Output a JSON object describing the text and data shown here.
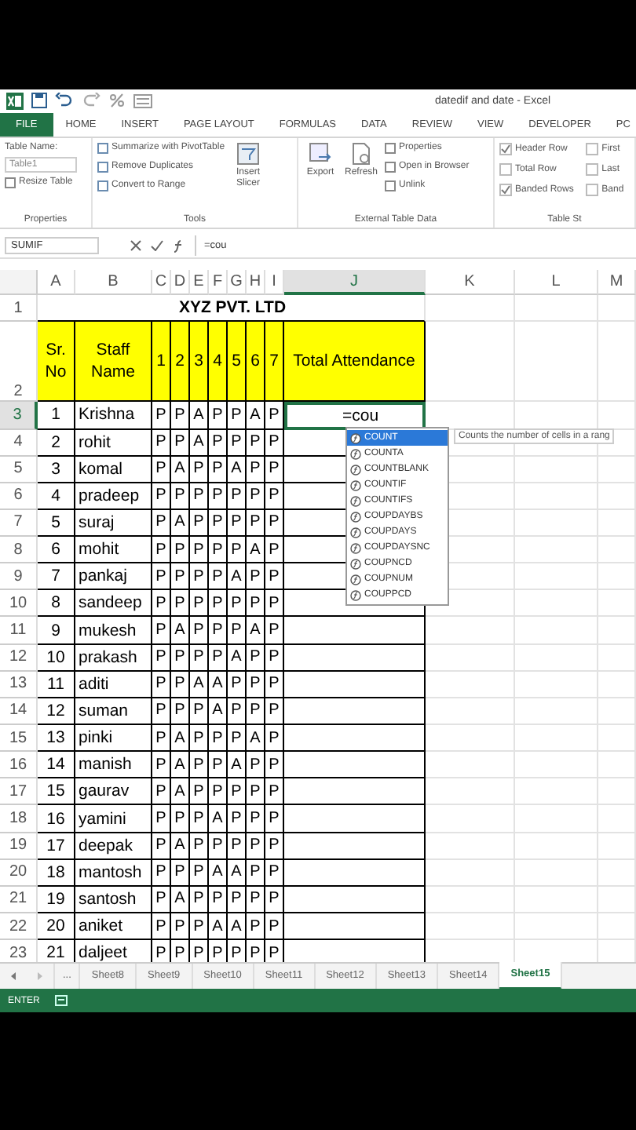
{
  "title_bar": {
    "title": "datedif and date - Excel"
  },
  "menu_tabs": [
    {
      "label": "FILE",
      "kind": "file",
      "selected": false
    },
    {
      "label": "HOME",
      "kind": "tab",
      "selected": false
    },
    {
      "label": "INSERT",
      "kind": "tab",
      "selected": false
    },
    {
      "label": "PAGE LAYOUT",
      "kind": "tab",
      "selected": false
    },
    {
      "label": "FORMULAS",
      "kind": "tab",
      "selected": false
    },
    {
      "label": "DATA",
      "kind": "tab",
      "selected": false
    },
    {
      "label": "REVIEW",
      "kind": "tab",
      "selected": false
    },
    {
      "label": "VIEW",
      "kind": "tab",
      "selected": false
    },
    {
      "label": "DEVELOPER",
      "kind": "tab",
      "selected": false
    },
    {
      "label": "PC",
      "kind": "tab",
      "selected": false
    }
  ],
  "ribbon": {
    "properties": {
      "label": "Table Name:",
      "value": "Table1",
      "resize": "Resize Table",
      "caption": "Properties"
    },
    "tools": {
      "items": [
        "Summarize with PivotTable",
        "Remove Duplicates",
        "Convert to Range"
      ],
      "slicer": "Insert Slicer",
      "caption": "Tools"
    },
    "external": {
      "export": "Export",
      "refresh": "Refresh",
      "items": [
        "Properties",
        "Open in Browser",
        "Unlink"
      ],
      "caption": "External Table Data"
    },
    "style_options": {
      "options": [
        {
          "label": "Header Row",
          "checked": true
        },
        {
          "label": "Total Row",
          "checked": false
        },
        {
          "label": "Banded Rows",
          "checked": true
        },
        {
          "label": "First",
          "checked": false
        },
        {
          "label": "Last",
          "checked": false
        },
        {
          "label": "Band",
          "checked": false
        }
      ],
      "caption": "Table St"
    }
  },
  "formula_bar": {
    "name_box": "SUMIF",
    "formula": "=cou"
  },
  "columns": [
    {
      "label": "A",
      "selected": false
    },
    {
      "label": "B",
      "selected": false
    },
    {
      "label": "C",
      "selected": false
    },
    {
      "label": "D",
      "selected": false
    },
    {
      "label": "E",
      "selected": false
    },
    {
      "label": "F",
      "selected": false
    },
    {
      "label": "G",
      "selected": false
    },
    {
      "label": "H",
      "selected": false
    },
    {
      "label": "I",
      "selected": false
    },
    {
      "label": "J",
      "selected": true
    },
    {
      "label": "K",
      "selected": false
    },
    {
      "label": "L",
      "selected": false
    },
    {
      "label": "M",
      "selected": false
    }
  ],
  "sheet": {
    "title_row": {
      "number": "1",
      "selected": false,
      "title": "XYZ PVT. LTD"
    },
    "header_row": {
      "number": "2",
      "selected": false,
      "headers": [
        "Sr. No",
        "Staff Name",
        "1",
        "2",
        "3",
        "4",
        "5",
        "6",
        "7",
        "Total Attendance"
      ]
    },
    "rows": [
      {
        "number": "3",
        "selected": true,
        "sr": "1",
        "name": "Krishna",
        "days": [
          "P",
          "P",
          "A",
          "P",
          "P",
          "A",
          "P"
        ],
        "total": "=cou"
      },
      {
        "number": "4",
        "selected": false,
        "sr": "2",
        "name": "rohit",
        "days": [
          "P",
          "P",
          "A",
          "P",
          "P",
          "P",
          "P"
        ]
      },
      {
        "number": "5",
        "selected": false,
        "sr": "3",
        "name": "komal",
        "days": [
          "P",
          "A",
          "P",
          "P",
          "A",
          "P",
          "P"
        ]
      },
      {
        "number": "6",
        "selected": false,
        "sr": "4",
        "name": "pradeep",
        "days": [
          "P",
          "P",
          "P",
          "P",
          "P",
          "P",
          "P"
        ]
      },
      {
        "number": "7",
        "selected": false,
        "sr": "5",
        "name": "suraj",
        "days": [
          "P",
          "A",
          "P",
          "P",
          "P",
          "P",
          "P"
        ]
      },
      {
        "number": "8",
        "selected": false,
        "sr": "6",
        "name": "mohit",
        "days": [
          "P",
          "P",
          "P",
          "P",
          "P",
          "A",
          "P"
        ]
      },
      {
        "number": "9",
        "selected": false,
        "sr": "7",
        "name": "pankaj",
        "days": [
          "P",
          "P",
          "P",
          "P",
          "A",
          "P",
          "P"
        ]
      },
      {
        "number": "10",
        "selected": false,
        "sr": "8",
        "name": "sandeep",
        "days": [
          "P",
          "P",
          "P",
          "P",
          "P",
          "P",
          "P"
        ]
      },
      {
        "number": "11",
        "selected": false,
        "sr": "9",
        "name": "mukesh",
        "days": [
          "P",
          "A",
          "P",
          "P",
          "P",
          "A",
          "P"
        ]
      },
      {
        "number": "12",
        "selected": false,
        "sr": "10",
        "name": "prakash",
        "days": [
          "P",
          "P",
          "P",
          "P",
          "A",
          "P",
          "P"
        ]
      },
      {
        "number": "13",
        "selected": false,
        "sr": "11",
        "name": "aditi",
        "days": [
          "P",
          "P",
          "A",
          "A",
          "P",
          "P",
          "P"
        ]
      },
      {
        "number": "14",
        "selected": false,
        "sr": "12",
        "name": "suman",
        "days": [
          "P",
          "P",
          "P",
          "A",
          "P",
          "P",
          "P"
        ]
      },
      {
        "number": "15",
        "selected": false,
        "sr": "13",
        "name": "pinki",
        "days": [
          "P",
          "A",
          "P",
          "P",
          "P",
          "A",
          "P"
        ]
      },
      {
        "number": "16",
        "selected": false,
        "sr": "14",
        "name": "manish",
        "days": [
          "P",
          "A",
          "P",
          "P",
          "A",
          "P",
          "P"
        ]
      },
      {
        "number": "17",
        "selected": false,
        "sr": "15",
        "name": "gaurav",
        "days": [
          "P",
          "A",
          "P",
          "P",
          "P",
          "P",
          "P"
        ]
      },
      {
        "number": "18",
        "selected": false,
        "sr": "16",
        "name": "yamini",
        "days": [
          "P",
          "P",
          "P",
          "A",
          "P",
          "P",
          "P"
        ]
      },
      {
        "number": "19",
        "selected": false,
        "sr": "17",
        "name": "deepak",
        "days": [
          "P",
          "A",
          "P",
          "P",
          "P",
          "P",
          "P"
        ]
      },
      {
        "number": "20",
        "selected": false,
        "sr": "18",
        "name": "mantosh",
        "days": [
          "P",
          "P",
          "P",
          "A",
          "A",
          "P",
          "P"
        ]
      },
      {
        "number": "21",
        "selected": false,
        "sr": "19",
        "name": "santosh",
        "days": [
          "P",
          "A",
          "P",
          "P",
          "P",
          "P",
          "P"
        ]
      },
      {
        "number": "22",
        "selected": false,
        "sr": "20",
        "name": "aniket",
        "days": [
          "P",
          "P",
          "P",
          "A",
          "A",
          "P",
          "P"
        ]
      },
      {
        "number": "23",
        "selected": false,
        "sr": "21",
        "name": "daljeet",
        "days": [
          "P",
          "P",
          "P",
          "P",
          "P",
          "P",
          "P"
        ]
      }
    ]
  },
  "autocomplete": {
    "items": [
      {
        "label": "COUNT",
        "selected": true
      },
      {
        "label": "COUNTA",
        "selected": false
      },
      {
        "label": "COUNTBLANK",
        "selected": false
      },
      {
        "label": "COUNTIF",
        "selected": false
      },
      {
        "label": "COUNTIFS",
        "selected": false
      },
      {
        "label": "COUPDAYBS",
        "selected": false
      },
      {
        "label": "COUPDAYS",
        "selected": false
      },
      {
        "label": "COUPDAYSNC",
        "selected": false
      },
      {
        "label": "COUPNCD",
        "selected": false
      },
      {
        "label": "COUPNUM",
        "selected": false
      },
      {
        "label": "COUPPCD",
        "selected": false
      }
    ],
    "tooltip": "Counts the number of cells in a rang"
  },
  "sheet_tabs": {
    "more": "...",
    "tabs": [
      {
        "label": "Sheet8",
        "selected": false
      },
      {
        "label": "Sheet9",
        "selected": false
      },
      {
        "label": "Sheet10",
        "selected": false
      },
      {
        "label": "Sheet11",
        "selected": false
      },
      {
        "label": "Sheet12",
        "selected": false
      },
      {
        "label": "Sheet13",
        "selected": false
      },
      {
        "label": "Sheet14",
        "selected": false
      },
      {
        "label": "Sheet15",
        "selected": true
      }
    ]
  },
  "status_bar": {
    "mode": "ENTER"
  }
}
